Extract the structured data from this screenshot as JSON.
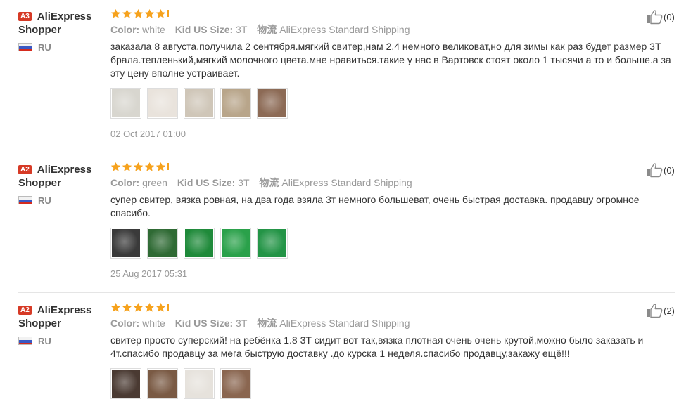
{
  "colors": {
    "star": "#f6a21d",
    "badge": "#d63a26",
    "muted": "#999999"
  },
  "reviews": [
    {
      "level": "A3",
      "name": "AliExpress",
      "name2": "Shopper",
      "country": "RU",
      "rating": 5,
      "color_label": "Color:",
      "color_value": "white",
      "size_label": "Kid US Size:",
      "size_value": "3T",
      "ship_label": "物流",
      "ship_value": "AliExpress Standard Shipping",
      "text": "заказала 8 августа,получила 2 сентября.мягкий свитер,нам 2,4 немного великоват,но для зимы как раз будет размер 3Т брала.тепленький,мягкий молочного цвета.мне нравиться.такие у нас в Вартовск стоят около 1 тысячи а то и больше.а за эту цену вполне устраивает.",
      "date": "02 Oct 2017 01:00",
      "helpful": "(0)",
      "photos": [
        "#d8d6cf",
        "#e9e3dc",
        "#cfc6b8",
        "#b8a58a",
        "#8c6a55"
      ]
    },
    {
      "level": "A2",
      "name": "AliExpress",
      "name2": "Shopper",
      "country": "RU",
      "rating": 5,
      "color_label": "Color:",
      "color_value": "green",
      "size_label": "Kid US Size:",
      "size_value": "3T",
      "ship_label": "物流",
      "ship_value": "AliExpress Standard Shipping",
      "text": "супер свитер, вязка ровная, на два года взяла 3т немного большеват, очень быстрая доставка. продавцу огромное спасибо.",
      "date": "25 Aug 2017 05:31",
      "helpful": "(0)",
      "photos": [
        "#3a3a3a",
        "#2f6a34",
        "#1f8a3a",
        "#2aa14a",
        "#239446"
      ]
    },
    {
      "level": "A2",
      "name": "AliExpress",
      "name2": "Shopper",
      "country": "RU",
      "rating": 5,
      "color_label": "Color:",
      "color_value": "white",
      "size_label": "Kid US Size:",
      "size_value": "3T",
      "ship_label": "物流",
      "ship_value": "AliExpress Standard Shipping",
      "text": "свитер просто суперский! на ребёнка 1.8 3Т сидит вот так,вязка плотная очень очень крутой,можно было заказать и 4т.спасибо продавцу за мега быструю доставку .до курска 1 неделя.спасибо продавцу,закажу ещё!!!",
      "date": "",
      "helpful": "(2)",
      "photos": [
        "#4a3a32",
        "#7a5a44",
        "#e6e2dc",
        "#8a6650"
      ]
    }
  ]
}
